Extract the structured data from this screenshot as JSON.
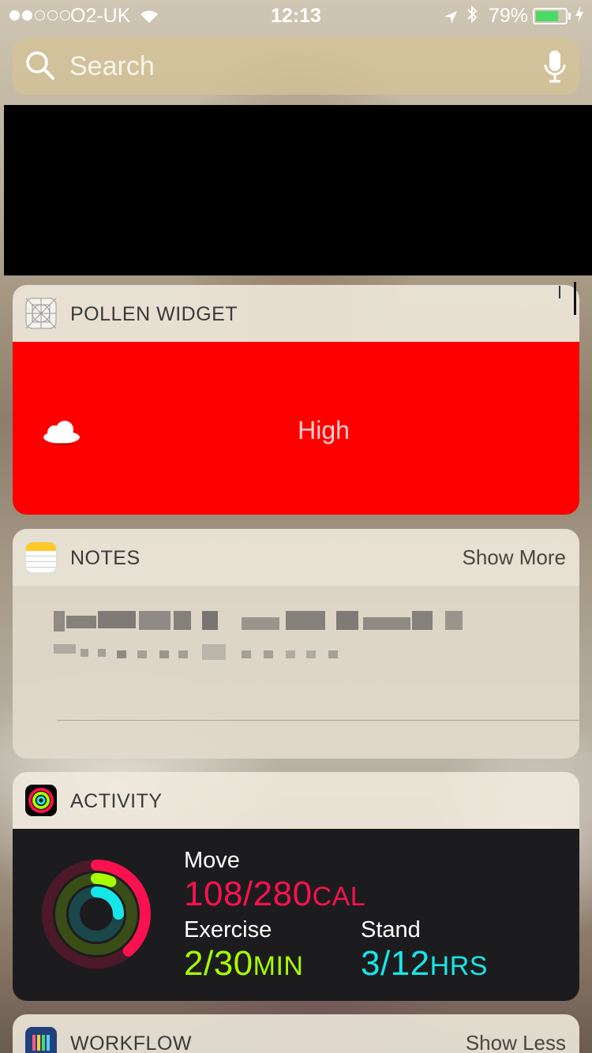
{
  "status_bar": {
    "carrier": "O2-UK",
    "time": "12:13",
    "battery_percent": "79%",
    "battery_level": 0.79,
    "signal_strength": 2,
    "colors": {
      "battery_fill": "#4cd964"
    }
  },
  "search": {
    "placeholder": "Search"
  },
  "widgets": {
    "pollen": {
      "title": "POLLEN WIDGET",
      "level": "High",
      "background_color": "#ff0000"
    },
    "notes": {
      "title": "NOTES",
      "action": "Show More"
    },
    "activity": {
      "title": "ACTIVITY",
      "move": {
        "label": "Move",
        "value": "108/280",
        "unit": "CAL",
        "current": 108,
        "goal": 280,
        "color": "#fa114f"
      },
      "exercise": {
        "label": "Exercise",
        "value": "2/30",
        "unit": "MIN",
        "current": 2,
        "goal": 30,
        "color": "#a6ff00"
      },
      "stand": {
        "label": "Stand",
        "value": "3/12",
        "unit": "HRS",
        "current": 3,
        "goal": 12,
        "color": "#17e6e9"
      }
    },
    "workflow": {
      "title": "WORKFLOW",
      "action": "Show Less"
    }
  }
}
